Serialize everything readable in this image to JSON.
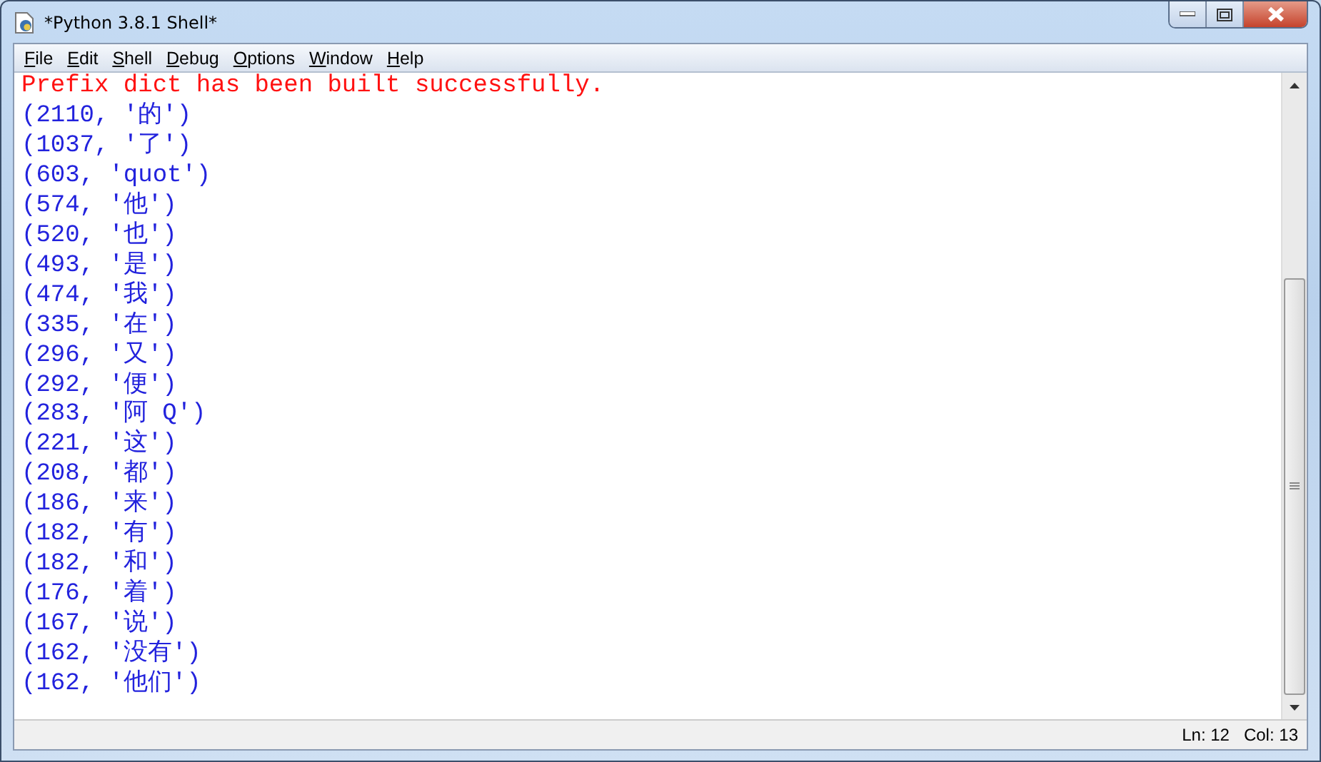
{
  "window": {
    "title": "*Python 3.8.1 Shell*"
  },
  "menu": [
    {
      "label": "File"
    },
    {
      "label": "Edit"
    },
    {
      "label": "Shell"
    },
    {
      "label": "Debug"
    },
    {
      "label": "Options"
    },
    {
      "label": "Window"
    },
    {
      "label": "Help"
    }
  ],
  "output": [
    {
      "kind": "stderr",
      "text": "Prefix dict has been built successfully."
    },
    {
      "kind": "stdout",
      "text": "(2110, '的')"
    },
    {
      "kind": "stdout",
      "text": "(1037, '了')"
    },
    {
      "kind": "stdout",
      "text": "(603, 'quot')"
    },
    {
      "kind": "stdout",
      "text": "(574, '他')"
    },
    {
      "kind": "stdout",
      "text": "(520, '也')"
    },
    {
      "kind": "stdout",
      "text": "(493, '是')"
    },
    {
      "kind": "stdout",
      "text": "(474, '我')"
    },
    {
      "kind": "stdout",
      "text": "(335, '在')"
    },
    {
      "kind": "stdout",
      "text": "(296, '又')"
    },
    {
      "kind": "stdout",
      "text": "(292, '便')"
    },
    {
      "kind": "stdout",
      "text": "(283, '阿 Q')"
    },
    {
      "kind": "stdout",
      "text": "(221, '这')"
    },
    {
      "kind": "stdout",
      "text": "(208, '都')"
    },
    {
      "kind": "stdout",
      "text": "(186, '来')"
    },
    {
      "kind": "stdout",
      "text": "(182, '有')"
    },
    {
      "kind": "stdout",
      "text": "(182, '和')"
    },
    {
      "kind": "stdout",
      "text": "(176, '着')"
    },
    {
      "kind": "stdout",
      "text": "(167, '说')"
    },
    {
      "kind": "stdout",
      "text": "(162, '没有')"
    },
    {
      "kind": "stdout",
      "text": "(162, '他们')"
    }
  ],
  "status_bar": {
    "line": "Ln: 12",
    "column": "Col: 13"
  }
}
